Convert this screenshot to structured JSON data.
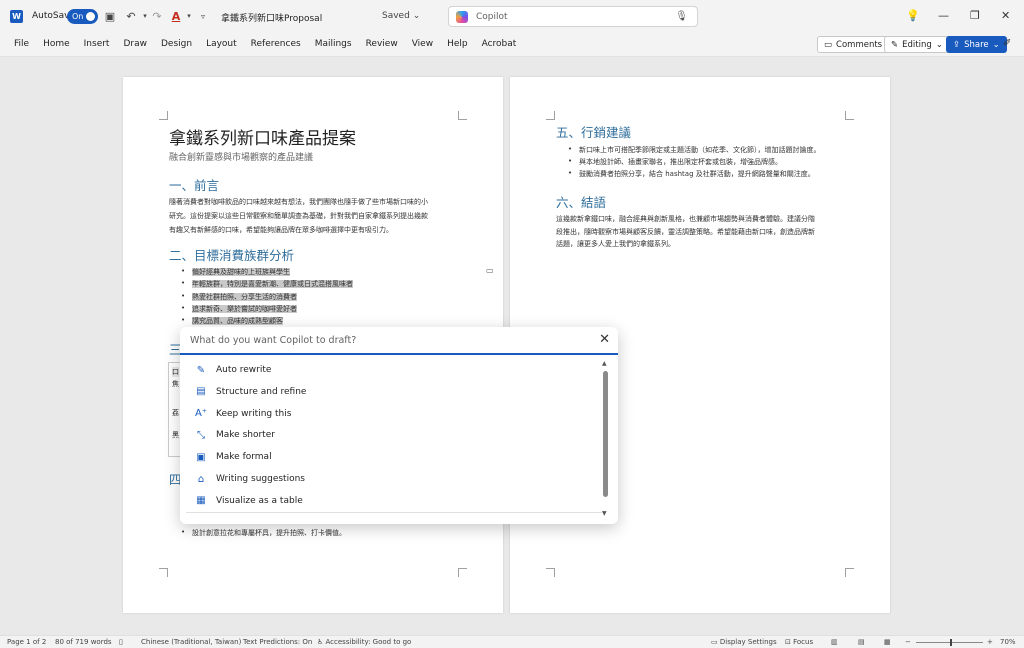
{
  "titlebar": {
    "autosave_label": "AutoSave",
    "autosave_state": "On",
    "document_title": "拿鐵系列新口味Proposal",
    "save_status": "Saved",
    "search_label": "Copilot"
  },
  "ribbon": {
    "tabs": [
      "File",
      "Home",
      "Insert",
      "Draw",
      "Design",
      "Layout",
      "References",
      "Mailings",
      "Review",
      "View",
      "Help",
      "Acrobat"
    ],
    "comments_label": "Comments",
    "editing_label": "Editing",
    "share_label": "Share"
  },
  "doc": {
    "title": "拿鐵系列新口味產品提案",
    "subtitle": "融合創新靈感與市場觀察的產品建議",
    "h_intro": "一、前言",
    "intro_lines": [
      "隨著消費者對咖啡飲品的口味越來越有想法，我們團隊也隨手做了些市場新口味的小",
      "研究。這份提案以這些日常觀察和簡單調查為基礎，針對我們自家拿鐵系列提出幾款",
      "有趣又有新鮮感的口味，希望能夠讓品牌在眾多咖啡選擇中更有吸引力。"
    ],
    "h_target": "二、目標消費族群分析",
    "target_items": [
      "偏好經典及甜味的上班族與學生",
      "年輕族群，特別是喜愛新潮、健康或日式混搭風味者",
      "熱愛社群拍照、分享生活的消費者",
      "追求新奇、樂於嘗試的咖啡愛好者",
      "講究品質、品味的成熟型顧客"
    ],
    "partial_h3": "三",
    "partial_rows": [
      "口",
      "焦",
      "荔",
      "黑"
    ],
    "partial_h4": "四",
    "last_item": "設計創意拉花和專屬杯具，提升拍照、打卡價值。",
    "h_marketing": "五、行銷建議",
    "marketing_items": [
      "新口味上市可搭配季節限定或主題活動（如花季、文化節），增加話題討論度。",
      "與本地設計師、插畫家聯名，推出限定杯套或包裝，增強品牌感。",
      "鼓勵消費者拍照分享，結合 hashtag 及社群活動，提升網路聲量和關注度。"
    ],
    "h_conclusion": "六、結語",
    "conclusion_lines": [
      "這幾款新拿鐵口味，融合經典與創新風格，也兼顧市場趨勢與消費者體驗。建議分階",
      "段推出，隨時觀察市場與顧客反饋，靈活調整策略。希望能藉由新口味，創造品牌新",
      "話題，讓更多人愛上我們的拿鐵系列。"
    ]
  },
  "copilot": {
    "placeholder": "What do you want Copilot to draft?",
    "items": [
      {
        "label": "Auto rewrite",
        "icon": "pen-sparkle-icon"
      },
      {
        "label": "Structure and refine",
        "icon": "document-icon"
      },
      {
        "label": "Keep writing this",
        "icon": "text-add-icon"
      },
      {
        "label": "Make shorter",
        "icon": "arrows-shrink-icon"
      },
      {
        "label": "Make formal",
        "icon": "briefcase-icon"
      },
      {
        "label": "Writing suggestions",
        "icon": "graduation-cap-icon"
      },
      {
        "label": "Visualize as a table",
        "icon": "table-icon"
      }
    ]
  },
  "statusbar": {
    "page": "Page 1 of 2",
    "words": "80 of 719 words",
    "language": "Chinese (Traditional, Taiwan)",
    "predictions": "Text Predictions: On",
    "accessibility": "Accessibility: Good to go",
    "display_settings": "Display Settings",
    "focus": "Focus",
    "zoom": "70%"
  },
  "colors": {
    "accent": "#185abd",
    "heading": "#2f6e9c",
    "highlight": "#c9c9c9"
  }
}
